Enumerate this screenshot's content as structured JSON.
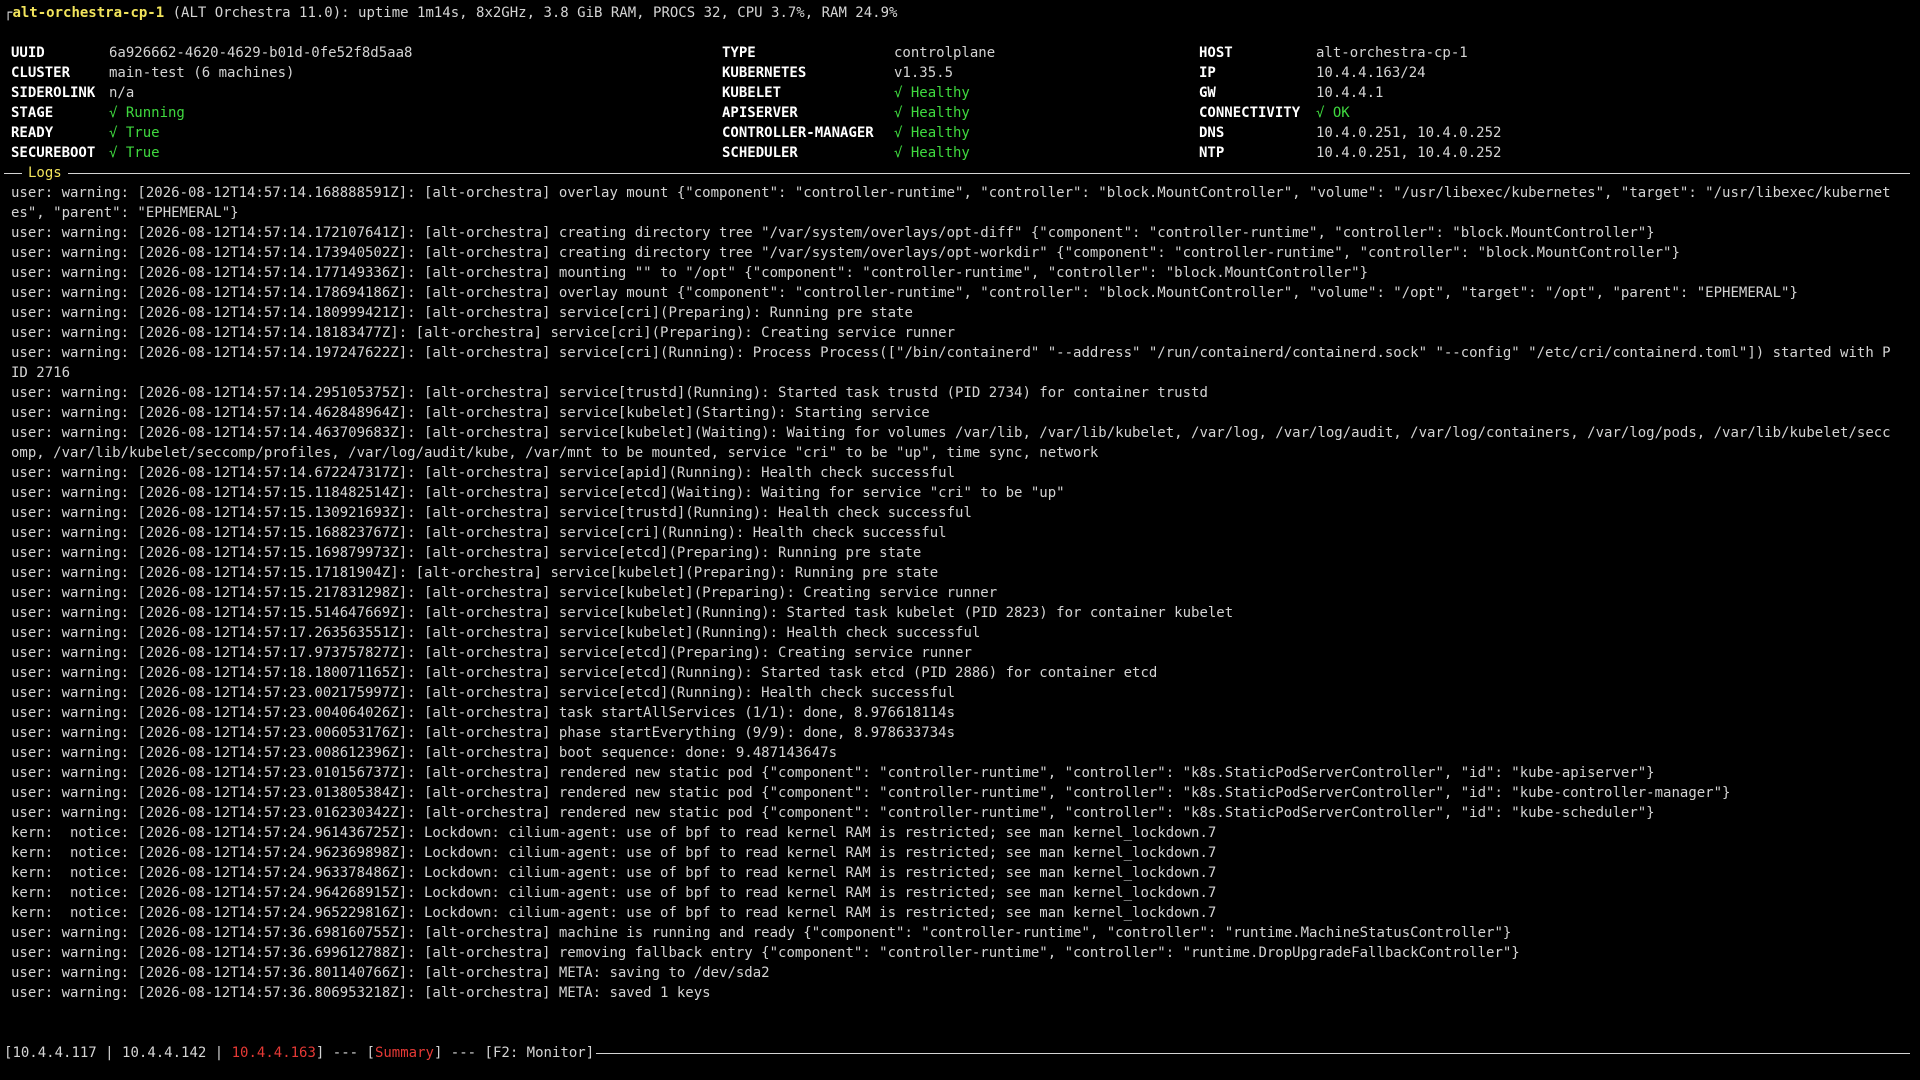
{
  "header": {
    "corner": "┌",
    "hostname": "alt-orchestra-cp-1",
    "details": " (ALT Orchestra 11.0): uptime 1m14s, 8x2GHz, 3.8 GiB RAM, PROCS 32, CPU 3.7%, RAM 24.9%"
  },
  "summary": {
    "col1": [
      {
        "label": "UUID",
        "value": "6a926662-4620-4629-b01d-0fe52f8d5aa8",
        "ok": false
      },
      {
        "label": "CLUSTER",
        "value": "main-test (6 machines)",
        "ok": false
      },
      {
        "label": "SIDEROLINK",
        "value": "n/a",
        "ok": false
      },
      {
        "label": "STAGE",
        "value": "√ Running",
        "ok": true
      },
      {
        "label": "READY",
        "value": "√ True",
        "ok": true
      },
      {
        "label": "SECUREBOOT",
        "value": "√ True",
        "ok": true
      }
    ],
    "col2": [
      {
        "label": "TYPE",
        "value": "controlplane",
        "ok": false
      },
      {
        "label": "KUBERNETES",
        "value": "v1.35.5",
        "ok": false
      },
      {
        "label": "KUBELET",
        "value": "√ Healthy",
        "ok": true
      },
      {
        "label": "APISERVER",
        "value": "√ Healthy",
        "ok": true
      },
      {
        "label": "CONTROLLER-MANAGER",
        "value": "√ Healthy",
        "ok": true
      },
      {
        "label": "SCHEDULER",
        "value": "√ Healthy",
        "ok": true
      }
    ],
    "col3": [
      {
        "label": "HOST",
        "value": "alt-orchestra-cp-1",
        "ok": false
      },
      {
        "label": "IP",
        "value": "10.4.4.163/24",
        "ok": false
      },
      {
        "label": "GW",
        "value": "10.4.4.1",
        "ok": false
      },
      {
        "label": "CONNECTIVITY",
        "value": "√ OK",
        "ok": true
      },
      {
        "label": "DNS",
        "value": "10.4.0.251, 10.4.0.252",
        "ok": false
      },
      {
        "label": "NTP",
        "value": "10.4.0.251, 10.4.0.252",
        "ok": false
      }
    ]
  },
  "logs": {
    "title": "Logs",
    "lines": [
      "user: warning: [2026-08-12T14:57:14.168888591Z]: [alt-orchestra] overlay mount {\"component\": \"controller-runtime\", \"controller\": \"block.MountController\", \"volume\": \"/usr/libexec/kubernetes\", \"target\": \"/usr/libexec/kubernetes\", \"parent\": \"EPHEMERAL\"}",
      "user: warning: [2026-08-12T14:57:14.172107641Z]: [alt-orchestra] creating directory tree \"/var/system/overlays/opt-diff\" {\"component\": \"controller-runtime\", \"controller\": \"block.MountController\"}",
      "user: warning: [2026-08-12T14:57:14.173940502Z]: [alt-orchestra] creating directory tree \"/var/system/overlays/opt-workdir\" {\"component\": \"controller-runtime\", \"controller\": \"block.MountController\"}",
      "user: warning: [2026-08-12T14:57:14.177149336Z]: [alt-orchestra] mounting \"\" to \"/opt\" {\"component\": \"controller-runtime\", \"controller\": \"block.MountController\"}",
      "user: warning: [2026-08-12T14:57:14.178694186Z]: [alt-orchestra] overlay mount {\"component\": \"controller-runtime\", \"controller\": \"block.MountController\", \"volume\": \"/opt\", \"target\": \"/opt\", \"parent\": \"EPHEMERAL\"}",
      "user: warning: [2026-08-12T14:57:14.180999421Z]: [alt-orchestra] service[cri](Preparing): Running pre state",
      "user: warning: [2026-08-12T14:57:14.18183477Z]: [alt-orchestra] service[cri](Preparing): Creating service runner",
      "user: warning: [2026-08-12T14:57:14.197247622Z]: [alt-orchestra] service[cri](Running): Process Process([\"/bin/containerd\" \"--address\" \"/run/containerd/containerd.sock\" \"--config\" \"/etc/cri/containerd.toml\"]) started with PID 2716",
      "user: warning: [2026-08-12T14:57:14.295105375Z]: [alt-orchestra] service[trustd](Running): Started task trustd (PID 2734) for container trustd",
      "user: warning: [2026-08-12T14:57:14.462848964Z]: [alt-orchestra] service[kubelet](Starting): Starting service",
      "user: warning: [2026-08-12T14:57:14.463709683Z]: [alt-orchestra] service[kubelet](Waiting): Waiting for volumes /var/lib, /var/lib/kubelet, /var/log, /var/log/audit, /var/log/containers, /var/log/pods, /var/lib/kubelet/seccomp, /var/lib/kubelet/seccomp/profiles, /var/log/audit/kube, /var/mnt to be mounted, service \"cri\" to be \"up\", time sync, network",
      "user: warning: [2026-08-12T14:57:14.672247317Z]: [alt-orchestra] service[apid](Running): Health check successful",
      "user: warning: [2026-08-12T14:57:15.118482514Z]: [alt-orchestra] service[etcd](Waiting): Waiting for service \"cri\" to be \"up\"",
      "user: warning: [2026-08-12T14:57:15.130921693Z]: [alt-orchestra] service[trustd](Running): Health check successful",
      "user: warning: [2026-08-12T14:57:15.168823767Z]: [alt-orchestra] service[cri](Running): Health check successful",
      "user: warning: [2026-08-12T14:57:15.169879973Z]: [alt-orchestra] service[etcd](Preparing): Running pre state",
      "user: warning: [2026-08-12T14:57:15.17181904Z]: [alt-orchestra] service[kubelet](Preparing): Running pre state",
      "user: warning: [2026-08-12T14:57:15.217831298Z]: [alt-orchestra] service[kubelet](Preparing): Creating service runner",
      "user: warning: [2026-08-12T14:57:15.514647669Z]: [alt-orchestra] service[kubelet](Running): Started task kubelet (PID 2823) for container kubelet",
      "user: warning: [2026-08-12T14:57:17.263563551Z]: [alt-orchestra] service[kubelet](Running): Health check successful",
      "user: warning: [2026-08-12T14:57:17.973757827Z]: [alt-orchestra] service[etcd](Preparing): Creating service runner",
      "user: warning: [2026-08-12T14:57:18.180071165Z]: [alt-orchestra] service[etcd](Running): Started task etcd (PID 2886) for container etcd",
      "user: warning: [2026-08-12T14:57:23.002175997Z]: [alt-orchestra] service[etcd](Running): Health check successful",
      "user: warning: [2026-08-12T14:57:23.004064026Z]: [alt-orchestra] task startAllServices (1/1): done, 8.976618114s",
      "user: warning: [2026-08-12T14:57:23.006053176Z]: [alt-orchestra] phase startEverything (9/9): done, 8.978633734s",
      "user: warning: [2026-08-12T14:57:23.008612396Z]: [alt-orchestra] boot sequence: done: 9.487143647s",
      "user: warning: [2026-08-12T14:57:23.010156737Z]: [alt-orchestra] rendered new static pod {\"component\": \"controller-runtime\", \"controller\": \"k8s.StaticPodServerController\", \"id\": \"kube-apiserver\"}",
      "user: warning: [2026-08-12T14:57:23.013805384Z]: [alt-orchestra] rendered new static pod {\"component\": \"controller-runtime\", \"controller\": \"k8s.StaticPodServerController\", \"id\": \"kube-controller-manager\"}",
      "user: warning: [2026-08-12T14:57:23.016230342Z]: [alt-orchestra] rendered new static pod {\"component\": \"controller-runtime\", \"controller\": \"k8s.StaticPodServerController\", \"id\": \"kube-scheduler\"}",
      "kern:  notice: [2026-08-12T14:57:24.961436725Z]: Lockdown: cilium-agent: use of bpf to read kernel RAM is restricted; see man kernel_lockdown.7",
      "kern:  notice: [2026-08-12T14:57:24.962369898Z]: Lockdown: cilium-agent: use of bpf to read kernel RAM is restricted; see man kernel_lockdown.7",
      "kern:  notice: [2026-08-12T14:57:24.963378486Z]: Lockdown: cilium-agent: use of bpf to read kernel RAM is restricted; see man kernel_lockdown.7",
      "kern:  notice: [2026-08-12T14:57:24.964268915Z]: Lockdown: cilium-agent: use of bpf to read kernel RAM is restricted; see man kernel_lockdown.7",
      "kern:  notice: [2026-08-12T14:57:24.965229816Z]: Lockdown: cilium-agent: use of bpf to read kernel RAM is restricted; see man kernel_lockdown.7",
      "user: warning: [2026-08-12T14:57:36.698160755Z]: [alt-orchestra] machine is running and ready {\"component\": \"controller-runtime\", \"controller\": \"runtime.MachineStatusController\"}",
      "user: warning: [2026-08-12T14:57:36.699612788Z]: [alt-orchestra] removing fallback entry {\"component\": \"controller-runtime\", \"controller\": \"runtime.DropUpgradeFallbackController\"}",
      "user: warning: [2026-08-12T14:57:36.801140766Z]: [alt-orchestra] META: saving to /dev/sda2",
      "user: warning: [2026-08-12T14:57:36.806953218Z]: [alt-orchestra] META: saved 1 keys"
    ]
  },
  "footer": {
    "open": "[",
    "node1": "10.4.4.117",
    "pipe1": " | ",
    "node2": "10.4.4.142",
    "pipe2": " | ",
    "node3": "10.4.4.163",
    "close": "]",
    "sep1": " --- [",
    "summary": "Summary",
    "sep2": "] --- [",
    "monitor": "F2: Monitor",
    "end": "]"
  },
  "colors": {
    "background": "#000000",
    "text": "#d4d4d4",
    "hostname": "#f2e45c",
    "ok": "#3fd93f",
    "active": "#e53935"
  }
}
